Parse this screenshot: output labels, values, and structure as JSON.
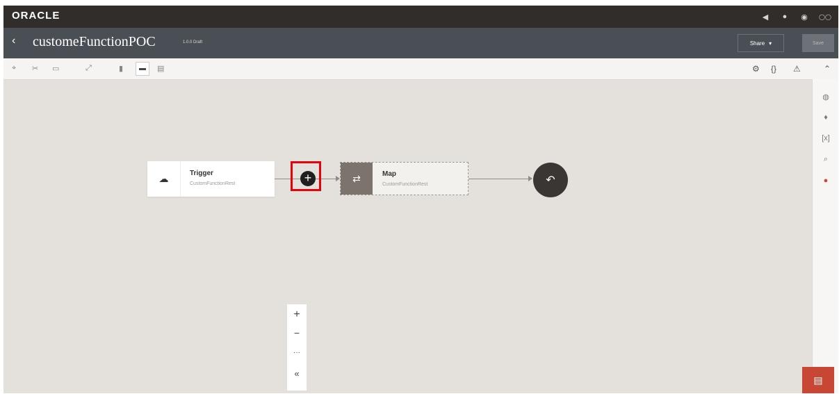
{
  "brand": {
    "logo": "ORACLE"
  },
  "header": {
    "back_icon": "chevron-left-icon",
    "title": "customeFunctionPOC",
    "version": "1.0.0 Draft",
    "share_label": "Share",
    "save_label": "Save"
  },
  "flow": {
    "trigger": {
      "title": "Trigger",
      "subtitle": "CustomFunctionRest"
    },
    "map": {
      "title": "Map",
      "subtitle": "CustomFunctionRest"
    }
  },
  "zoom": {
    "in": "+",
    "out": "−",
    "more": "···",
    "collapse": "«"
  },
  "colors": {
    "brand_bar": "#312d2a",
    "title_bar": "#4a4f56",
    "canvas": "#e4e1dc",
    "highlight": "#e8000b",
    "chat": "#c74634"
  }
}
